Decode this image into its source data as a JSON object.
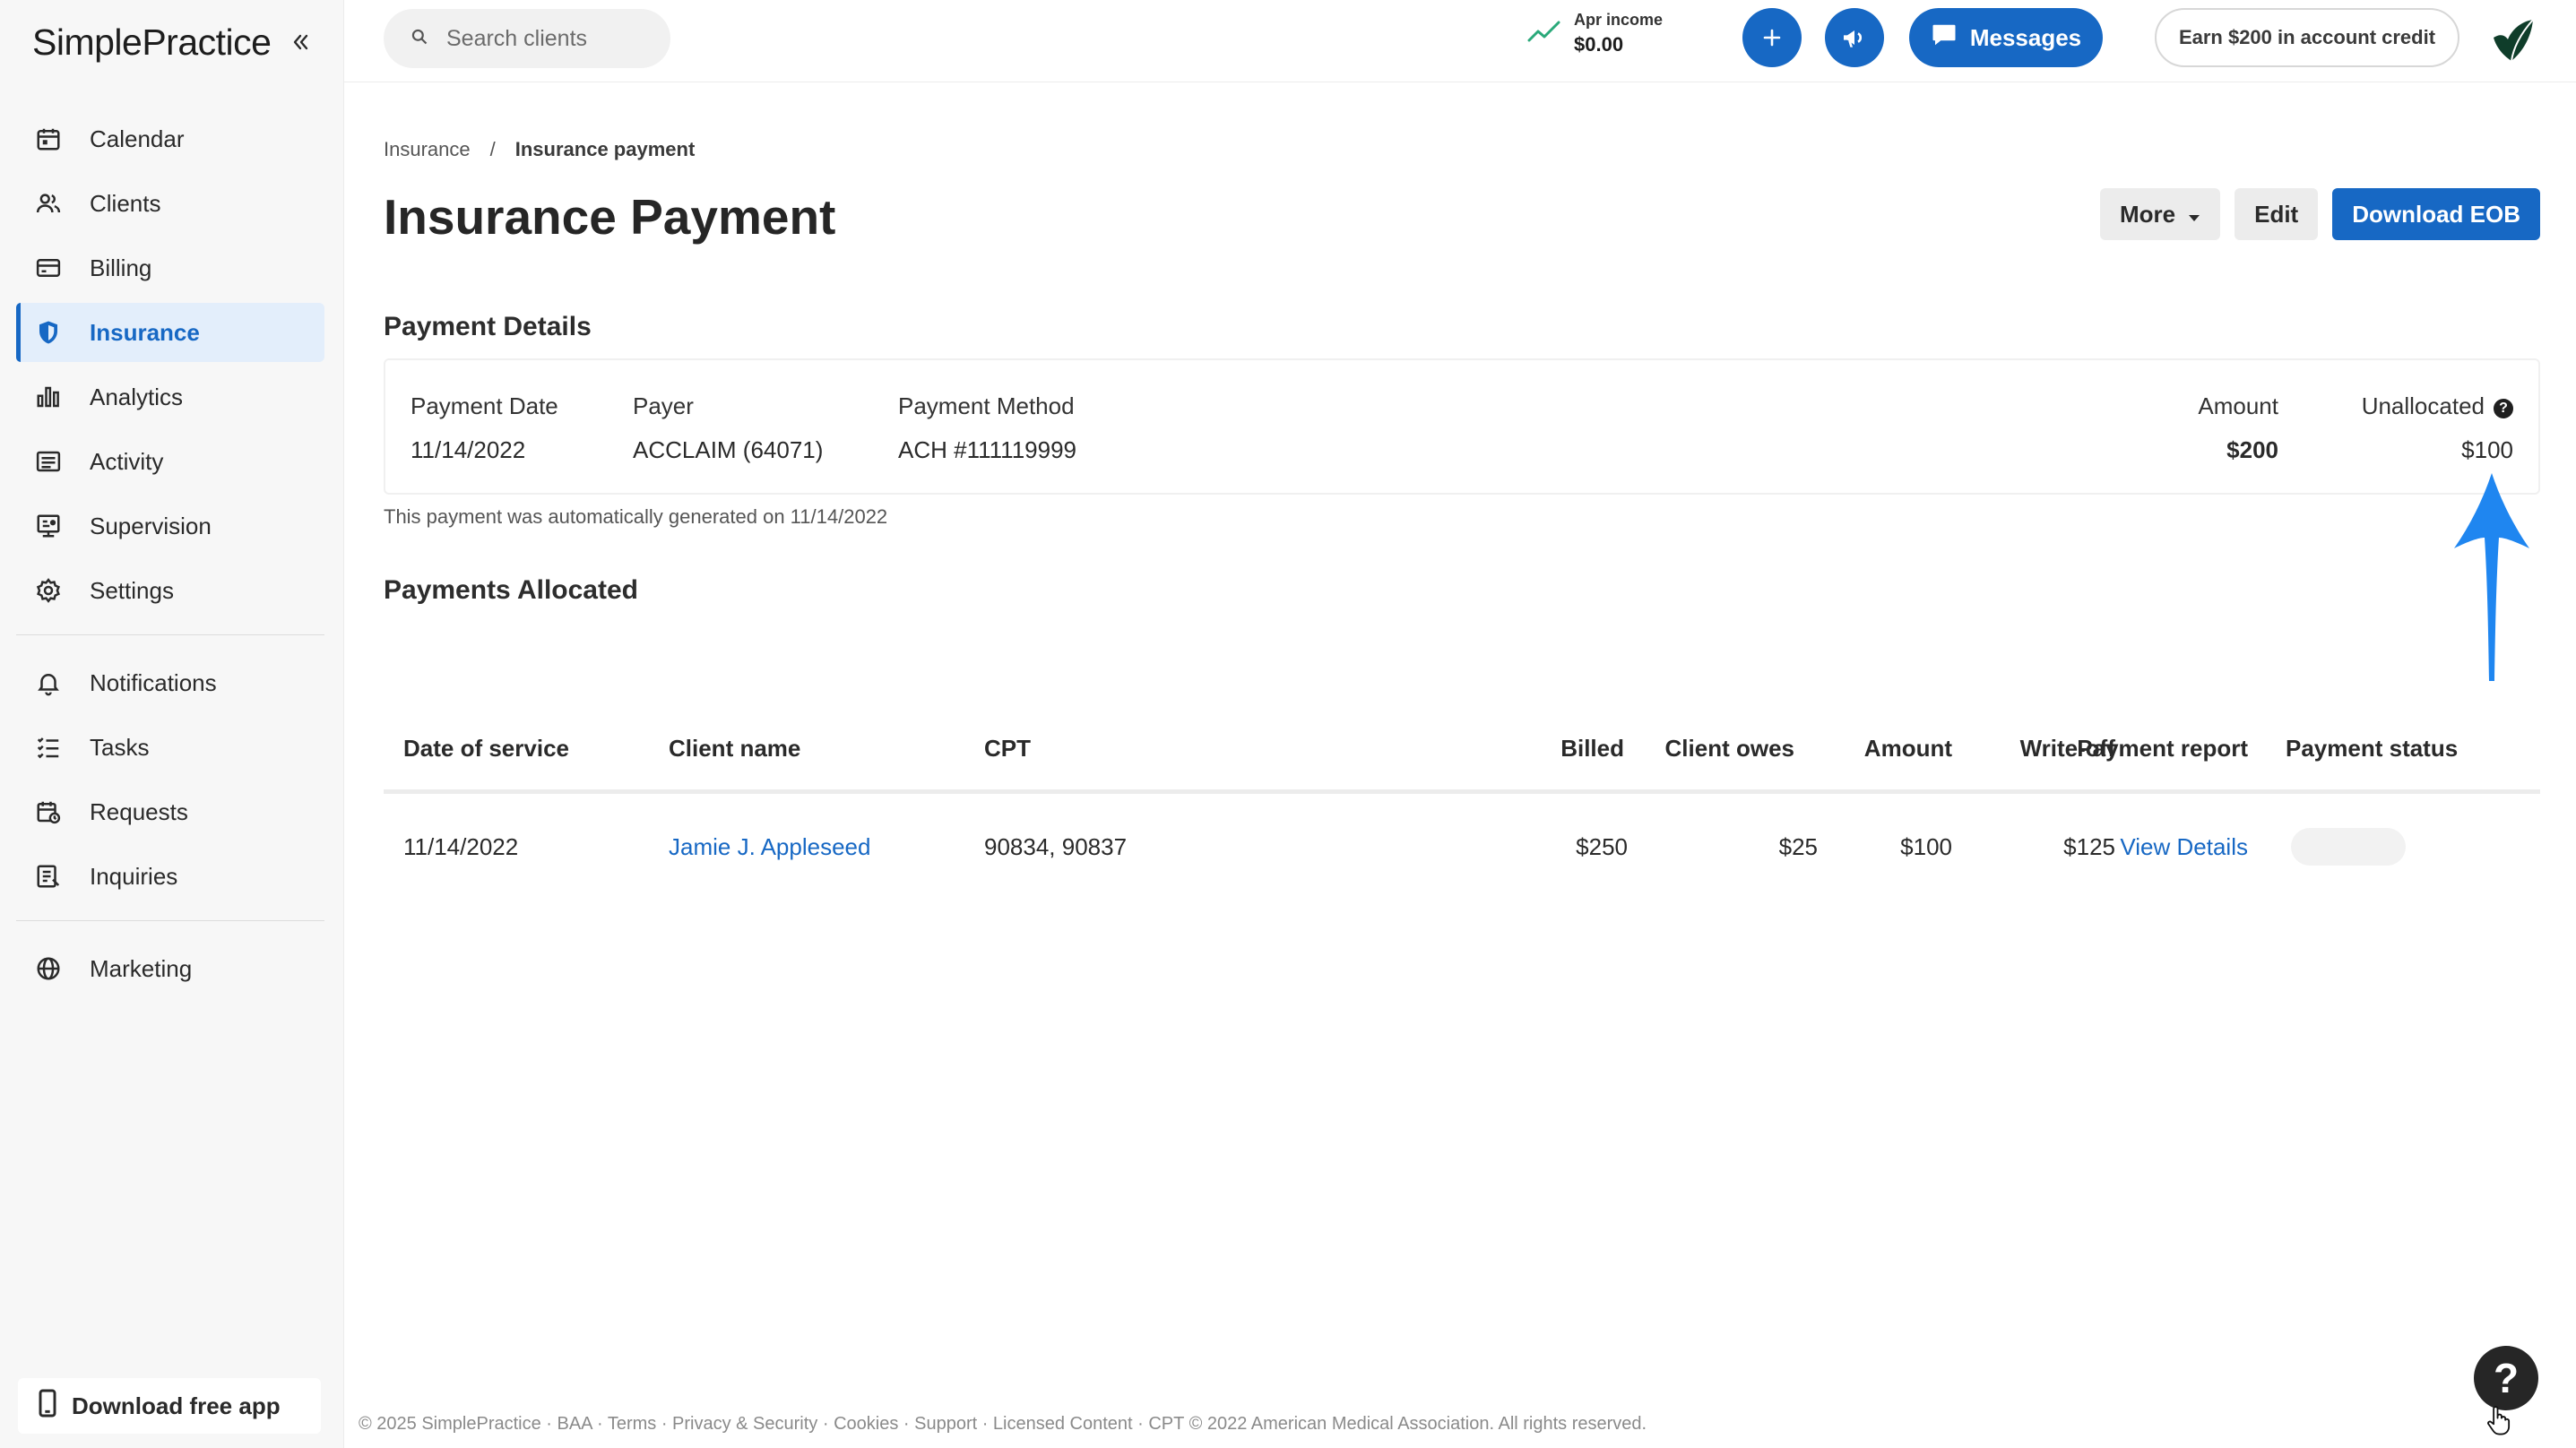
{
  "app": {
    "logo": "SimplePractice"
  },
  "sidebar": {
    "items": [
      {
        "label": "Calendar",
        "icon": "calendar-icon"
      },
      {
        "label": "Clients",
        "icon": "clients-icon"
      },
      {
        "label": "Billing",
        "icon": "billing-icon"
      },
      {
        "label": "Insurance",
        "icon": "shield-icon",
        "active": true
      },
      {
        "label": "Analytics",
        "icon": "analytics-icon"
      },
      {
        "label": "Activity",
        "icon": "activity-icon"
      },
      {
        "label": "Supervision",
        "icon": "supervision-icon"
      },
      {
        "label": "Settings",
        "icon": "gear-icon"
      }
    ],
    "items2": [
      {
        "label": "Notifications",
        "icon": "bell-icon"
      },
      {
        "label": "Tasks",
        "icon": "tasks-icon"
      },
      {
        "label": "Requests",
        "icon": "requests-icon"
      },
      {
        "label": "Inquiries",
        "icon": "inquiries-icon"
      }
    ],
    "items3": [
      {
        "label": "Marketing",
        "icon": "globe-icon"
      }
    ],
    "download_app": "Download free app"
  },
  "topbar": {
    "search_placeholder": "Search clients",
    "income_label": "Apr income",
    "income_value": "$0.00",
    "messages_label": "Messages",
    "earn_label": "Earn $200 in account credit"
  },
  "breadcrumb": {
    "parent": "Insurance",
    "separator": "/",
    "current": "Insurance payment"
  },
  "page": {
    "title": "Insurance Payment",
    "more_label": "More",
    "edit_label": "Edit",
    "download_label": "Download EOB"
  },
  "payment_details": {
    "section_title": "Payment Details",
    "payment_date_label": "Payment Date",
    "payment_date": "11/14/2022",
    "payer_label": "Payer",
    "payer": "ACCLAIM (64071)",
    "method_label": "Payment Method",
    "method": "ACH #111119999",
    "amount_label": "Amount",
    "amount": "$200",
    "unallocated_label": "Unallocated",
    "unallocated": "$100",
    "note": "This payment was automatically generated on 11/14/2022"
  },
  "allocated": {
    "section_title": "Payments Allocated",
    "columns": [
      "Date of service",
      "Client name",
      "CPT",
      "Billed",
      "Client owes",
      "Amount",
      "Write-off",
      "Payment report",
      "Payment status"
    ],
    "rows": [
      {
        "date": "11/14/2022",
        "client": "Jamie J. Appleseed",
        "cpt": "90834, 90837",
        "billed": "$250",
        "client_owes": "$25",
        "amount": "$100",
        "write_off": "$125",
        "report": "View Details",
        "status": ""
      }
    ]
  },
  "footer": {
    "text": "© 2025 SimplePractice · BAA · Terms · Privacy & Security · Cookies · Support · Licensed Content · CPT © 2022 American Medical Association. All rights reserved."
  },
  "help_label": "?",
  "colors": {
    "accent": "#1768c4",
    "annotation": "#1f86f0"
  }
}
